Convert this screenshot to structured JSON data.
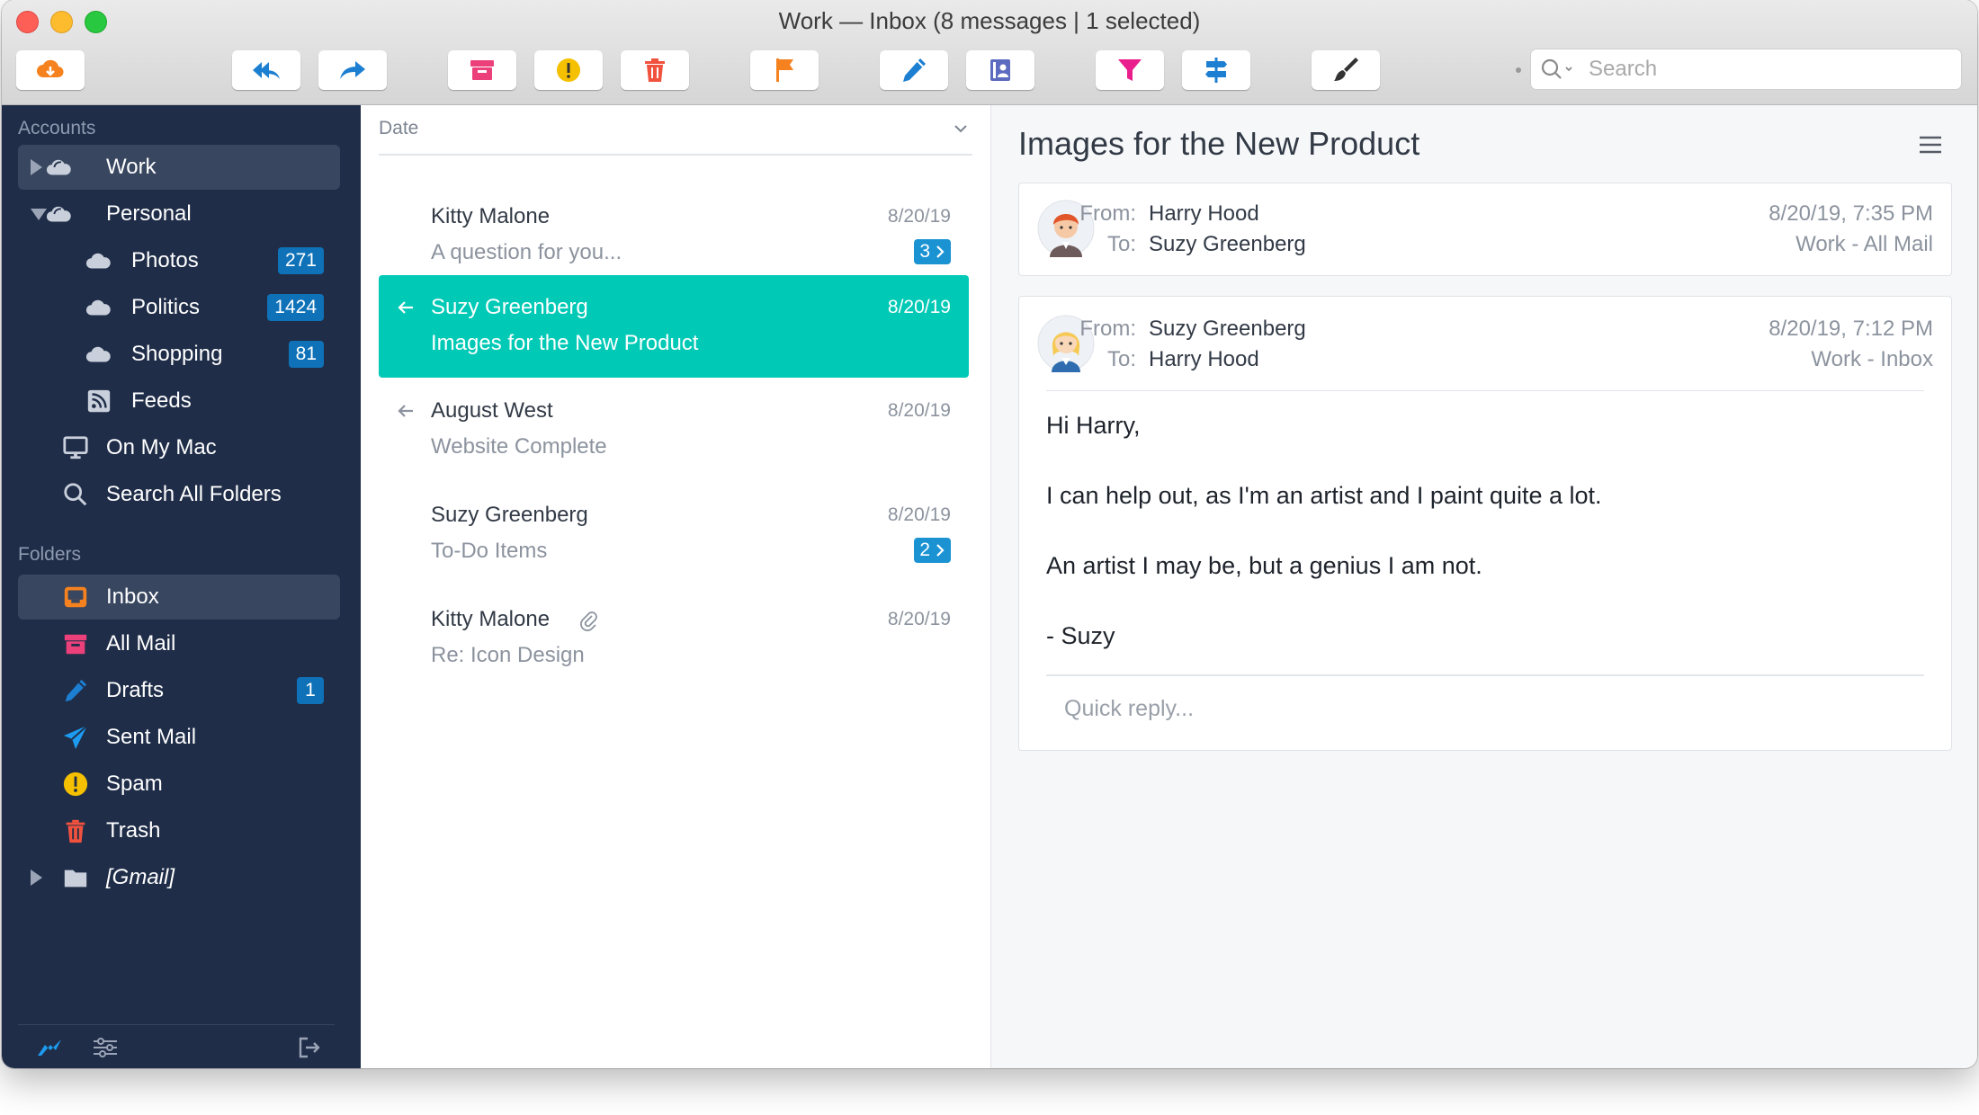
{
  "window": {
    "title": "Work — Inbox (8 messages | 1 selected)"
  },
  "toolbar": {
    "search_placeholder": "Search",
    "buttons": [
      {
        "name": "cloud-sync-button",
        "icon": "cloud-icon",
        "color": "#f5821f"
      },
      {
        "name": "reply-all-button",
        "icon": "reply-all-icon",
        "color": "#1c7fd1"
      },
      {
        "name": "forward-button",
        "icon": "forward-icon",
        "color": "#1c7fd1"
      },
      {
        "name": "archive-button",
        "icon": "archive-icon",
        "color": "#ec407a"
      },
      {
        "name": "spam-button",
        "icon": "exclamation-icon",
        "color": "#f5c000"
      },
      {
        "name": "delete-button",
        "icon": "trash-icon",
        "color": "#f0523e"
      },
      {
        "name": "flag-button",
        "icon": "flag-icon",
        "color": "#f5821f"
      },
      {
        "name": "compose-button",
        "icon": "pencil-icon",
        "color": "#1c7fd1"
      },
      {
        "name": "contacts-button",
        "icon": "contacts-icon",
        "color": "#5c6bc0"
      },
      {
        "name": "filter-button",
        "icon": "funnel-icon",
        "color": "#e91e8c"
      },
      {
        "name": "rules-button",
        "icon": "signpost-icon",
        "color": "#1c7fd1"
      },
      {
        "name": "customize-button",
        "icon": "brush-icon",
        "color": "#333333"
      }
    ]
  },
  "sidebar": {
    "accounts_label": "Accounts",
    "folders_label": "Folders",
    "accounts": [
      {
        "label": "Work",
        "badge": null
      },
      {
        "label": "Personal",
        "badge": null
      },
      {
        "label": "Photos",
        "badge": "271"
      },
      {
        "label": "Politics",
        "badge": "1424"
      },
      {
        "label": "Shopping",
        "badge": "81"
      },
      {
        "label": "Feeds",
        "badge": null
      },
      {
        "label": "On My Mac",
        "badge": null
      },
      {
        "label": "Search All Folders",
        "badge": null
      }
    ],
    "folders": [
      {
        "label": "Inbox",
        "badge": null
      },
      {
        "label": "All Mail",
        "badge": null
      },
      {
        "label": "Drafts",
        "badge": "1"
      },
      {
        "label": "Sent Mail",
        "badge": null
      },
      {
        "label": "Spam",
        "badge": null
      },
      {
        "label": "Trash",
        "badge": null
      },
      {
        "label": "[Gmail]",
        "badge": null
      }
    ]
  },
  "message_list": {
    "sort_label": "Date",
    "messages": [
      {
        "from": "Kitty Malone",
        "subject": "A question for you...",
        "date": "8/20/19",
        "count": "3"
      },
      {
        "from": "Suzy Greenberg",
        "subject": "Images for the New Product",
        "date": "8/20/19",
        "count": null
      },
      {
        "from": "August West",
        "subject": "Website Complete",
        "date": "8/20/19",
        "count": null
      },
      {
        "from": "Suzy Greenberg",
        "subject": "To-Do Items",
        "date": "8/20/19",
        "count": "2"
      },
      {
        "from": "Kitty Malone",
        "subject": "Re: Icon Design",
        "date": "8/20/19",
        "count": null
      }
    ]
  },
  "reader": {
    "title": "Images for the New Product",
    "from_label": "From:",
    "to_label": "To:",
    "message1": {
      "from": "Harry Hood",
      "to": "Suzy Greenberg",
      "datetime": "8/20/19, 7:35 PM",
      "folder": "Work - All Mail"
    },
    "message2": {
      "from": "Suzy Greenberg",
      "to": "Harry Hood",
      "datetime": "8/20/19, 7:12 PM",
      "folder": "Work - Inbox"
    },
    "body": [
      "Hi Harry,",
      "I can help out, as I'm an artist and I paint quite a lot.",
      "An artist I may be, but a genius I am not.",
      "- Suzy"
    ],
    "quick_reply_placeholder": "Quick reply..."
  },
  "colors": {
    "sidebar_bg": "#1f2d48",
    "selection_teal": "#00c9b6",
    "badge_blue": "#0f72b8"
  }
}
